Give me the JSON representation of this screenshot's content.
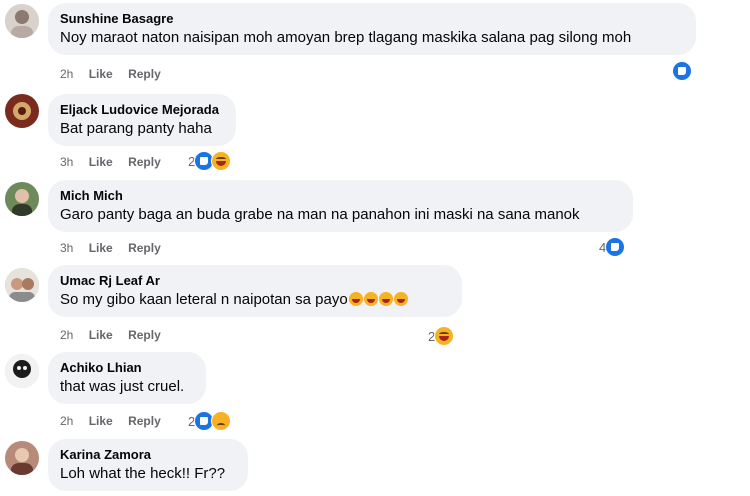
{
  "comments": [
    {
      "author": "Sunshine Basagre",
      "text": "Noy maraot naton naisipan moh amoyan brep tlagang maskika salana pag silong moh",
      "time": "2h",
      "like_label": "Like",
      "reply_label": "Reply",
      "reaction_count": "",
      "reactions": [
        "like"
      ]
    },
    {
      "author": "Eljack Ludovice Mejorada",
      "text": "Bat parang panty haha",
      "time": "3h",
      "like_label": "Like",
      "reply_label": "Reply",
      "reaction_count": "2",
      "reactions": [
        "like",
        "haha"
      ]
    },
    {
      "author": "Mich Mich",
      "text": "Garo panty baga an buda grabe na man na panahon ini maski na sana manok",
      "time": "3h",
      "like_label": "Like",
      "reply_label": "Reply",
      "reaction_count": "4",
      "reactions": [
        "like"
      ]
    },
    {
      "author": "Umac Rj Leaf Ar",
      "text": "So my gibo kaan leteral n naipotan sa payo",
      "text_emojis": [
        "haha",
        "haha",
        "haha",
        "haha"
      ],
      "time": "2h",
      "like_label": "Like",
      "reply_label": "Reply",
      "reaction_count": "2",
      "reactions": [
        "haha"
      ]
    },
    {
      "author": "Achiko Lhian",
      "text": "that was just cruel.",
      "time": "2h",
      "like_label": "Like",
      "reply_label": "Reply",
      "reaction_count": "2",
      "reactions": [
        "like",
        "sad"
      ]
    },
    {
      "author": "Karina Zamora",
      "text": "Loh what the heck!! Fr??"
    }
  ],
  "colors": {
    "bubble": "#f0f2f5",
    "meta_text": "#65676b",
    "like_blue": "#1b74e4",
    "emoji_yellow": "#f7b125"
  }
}
